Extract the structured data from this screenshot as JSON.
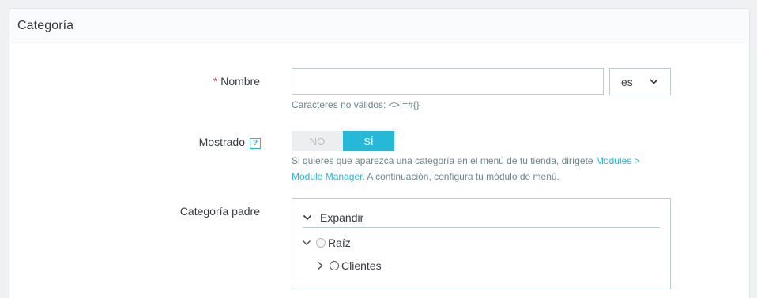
{
  "panel": {
    "title": "Categoría"
  },
  "name_field": {
    "required_mark": "*",
    "label": "Nombre",
    "value": "",
    "placeholder": "",
    "language": "es",
    "help": "Caracteres no válidos: <>;=#{}"
  },
  "display_field": {
    "label": "Mostrado",
    "help_icon_glyph": "?",
    "no_label": "NO",
    "yes_label": "SÍ",
    "selected": "SÍ",
    "help_line1_pre": "Si quieres que aparezca una categoría en el menú de tu tienda, dirígete ",
    "help_link1": "Modules >",
    "help_link2": "Module Manager",
    "help_line2_post": ". A continuación, configura tu módulo de menú."
  },
  "parent_field": {
    "label": "Categoría padre",
    "expand_label": "Expandir",
    "tree": [
      {
        "label": "Raíz",
        "state": "expanded"
      },
      {
        "label": "Clientes",
        "state": "collapsed"
      }
    ]
  },
  "colors": {
    "accent": "#25b9d7",
    "required": "#c05c67"
  }
}
